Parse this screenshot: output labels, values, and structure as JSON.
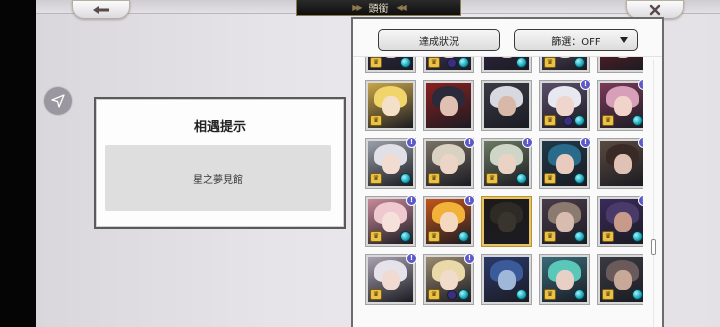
{
  "header": {
    "title": "頭銜",
    "back_icon": "left-arrow-icon",
    "close_icon": "close-icon"
  },
  "hint_dialog": {
    "title": "相遇提示",
    "location": "星之夢見館"
  },
  "panel": {
    "achievement_button": "達成狀況",
    "filter_label": "篩選：OFF"
  },
  "portraits": [
    {
      "hair": "#6a4ea0",
      "face": "#e8c9c0",
      "bg": "#3a2f55",
      "crown": true,
      "gem": true,
      "info": false,
      "lock": false
    },
    {
      "hair": "#7a6fb0",
      "face": "#ecd0c8",
      "bg": "#4a4070",
      "crown": true,
      "gem": true,
      "info": false,
      "lock": true
    },
    {
      "hair": "#5a3a7a",
      "face": "#e5c6bd",
      "bg": "#3b2a4f",
      "crown": false,
      "gem": true,
      "info": false,
      "lock": false
    },
    {
      "hair": "#e2d4a0",
      "face": "#f0d8cc",
      "bg": "#6a5a7a",
      "crown": true,
      "gem": true,
      "info": false,
      "lock": false
    },
    {
      "hair": "#b8262e",
      "face": "#edd2c6",
      "bg": "#7a1f2a",
      "crown": false,
      "gem": false,
      "info": false,
      "lock": false
    },
    {
      "hair": "#f1d56a",
      "face": "#f4e0c8",
      "bg": "#c9a64a",
      "crown": true,
      "gem": false,
      "info": false,
      "lock": false
    },
    {
      "hair": "#2a2a3a",
      "face": "#e0c0b0",
      "bg": "#8a1f1f",
      "crown": false,
      "gem": false,
      "info": false,
      "lock": false
    },
    {
      "hair": "#d8d8e0",
      "face": "#d8b8a8",
      "bg": "#3a3a46",
      "crown": false,
      "gem": false,
      "info": false,
      "lock": false
    },
    {
      "hair": "#e8e8f0",
      "face": "#efd6cc",
      "bg": "#5a4e6a",
      "crown": true,
      "gem": true,
      "info": true,
      "lock": true
    },
    {
      "hair": "#d8a0b8",
      "face": "#f0d4cc",
      "bg": "#7a3a5a",
      "crown": true,
      "gem": true,
      "info": true,
      "lock": false
    },
    {
      "hair": "#e0e0e6",
      "face": "#f2dcd2",
      "bg": "#9aa0aa",
      "crown": true,
      "gem": true,
      "info": true,
      "lock": false
    },
    {
      "hair": "#d9d2c2",
      "face": "#ecd4c6",
      "bg": "#7a7266",
      "crown": true,
      "gem": false,
      "info": true,
      "lock": false
    },
    {
      "hair": "#cfd6c8",
      "face": "#ead2c4",
      "bg": "#6a7a62",
      "crown": true,
      "gem": true,
      "info": true,
      "lock": false
    },
    {
      "hair": "#2a6a8a",
      "face": "#e8cabe",
      "bg": "#1f3a4a",
      "crown": true,
      "gem": true,
      "info": true,
      "lock": false
    },
    {
      "hair": "#3a2a26",
      "face": "#e0c2b4",
      "bg": "#5a4a40",
      "crown": false,
      "gem": false,
      "info": true,
      "lock": false
    },
    {
      "hair": "#f0c8d0",
      "face": "#f6e0da",
      "bg": "#c88a9a",
      "crown": true,
      "gem": true,
      "info": true,
      "lock": false
    },
    {
      "hair": "#f2b23a",
      "face": "#f4d8c0",
      "bg": "#c4551a",
      "crown": true,
      "gem": true,
      "info": true,
      "lock": false
    },
    {
      "hair": "#2e2a26",
      "face": "#3a342e",
      "bg": "#1e1a18",
      "crown": false,
      "gem": false,
      "info": false,
      "lock": false,
      "selected": true
    },
    {
      "hair": "#8a7a70",
      "face": "#d8bcb0",
      "bg": "#4a3a4a",
      "crown": true,
      "gem": true,
      "info": false,
      "lock": false
    },
    {
      "hair": "#4a3a6a",
      "face": "#c89a8a",
      "bg": "#3a2a5a",
      "crown": true,
      "gem": true,
      "info": true,
      "lock": false
    },
    {
      "hair": "#e6e2ea",
      "face": "#f0dad2",
      "bg": "#a8a2b0",
      "crown": true,
      "gem": false,
      "info": true,
      "lock": false
    },
    {
      "hair": "#e9d9a8",
      "face": "#f1dccc",
      "bg": "#9a8a70",
      "crown": true,
      "gem": true,
      "info": true,
      "lock": true
    },
    {
      "hair": "#3a5a9a",
      "face": "#a0b8d8",
      "bg": "#2a3a6a",
      "crown": false,
      "gem": true,
      "info": false,
      "lock": false
    },
    {
      "hair": "#5ac8b8",
      "face": "#e8d0c6",
      "bg": "#3a6a7a",
      "crown": true,
      "gem": true,
      "info": false,
      "lock": false
    },
    {
      "hair": "#6a5a5a",
      "face": "#c8a898",
      "bg": "#3a3a44",
      "crown": true,
      "gem": true,
      "info": false,
      "lock": false
    }
  ]
}
